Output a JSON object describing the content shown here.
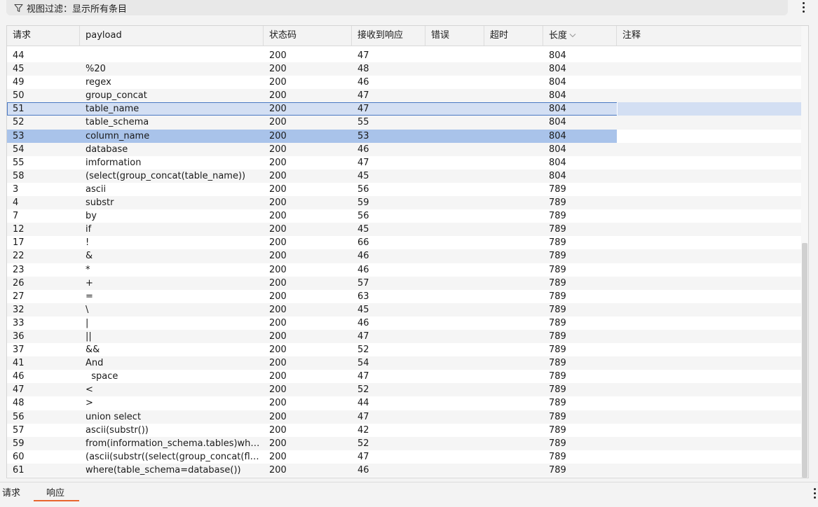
{
  "filter": {
    "label": "视图过滤：显示所有条目"
  },
  "columns": [
    "请求",
    "payload",
    "状态码",
    "接收到响应",
    "错误",
    "超时",
    "长度",
    "注释"
  ],
  "rows": [
    {
      "req": "44",
      "payload": "",
      "status": "200",
      "resp": "47",
      "err": "",
      "timeout": "",
      "len": "804",
      "note": ""
    },
    {
      "req": "45",
      "payload": "%20",
      "status": "200",
      "resp": "48",
      "err": "",
      "timeout": "",
      "len": "804",
      "note": ""
    },
    {
      "req": "49",
      "payload": "regex",
      "status": "200",
      "resp": "46",
      "err": "",
      "timeout": "",
      "len": "804",
      "note": ""
    },
    {
      "req": "50",
      "payload": "group_concat",
      "status": "200",
      "resp": "47",
      "err": "",
      "timeout": "",
      "len": "804",
      "note": ""
    },
    {
      "req": "51",
      "payload": "table_name",
      "status": "200",
      "resp": "47",
      "err": "",
      "timeout": "",
      "len": "804",
      "note": ""
    },
    {
      "req": "52",
      "payload": "table_schema",
      "status": "200",
      "resp": "55",
      "err": "",
      "timeout": "",
      "len": "804",
      "note": ""
    },
    {
      "req": "53",
      "payload": "column_name",
      "status": "200",
      "resp": "53",
      "err": "",
      "timeout": "",
      "len": "804",
      "note": ""
    },
    {
      "req": "54",
      "payload": "database",
      "status": "200",
      "resp": "46",
      "err": "",
      "timeout": "",
      "len": "804",
      "note": ""
    },
    {
      "req": "55",
      "payload": "imformation",
      "status": "200",
      "resp": "47",
      "err": "",
      "timeout": "",
      "len": "804",
      "note": ""
    },
    {
      "req": "58",
      "payload": "(select(group_concat(table_name))",
      "status": "200",
      "resp": "45",
      "err": "",
      "timeout": "",
      "len": "804",
      "note": ""
    },
    {
      "req": "3",
      "payload": "ascii",
      "status": "200",
      "resp": "56",
      "err": "",
      "timeout": "",
      "len": "789",
      "note": ""
    },
    {
      "req": "4",
      "payload": "substr",
      "status": "200",
      "resp": "59",
      "err": "",
      "timeout": "",
      "len": "789",
      "note": ""
    },
    {
      "req": "7",
      "payload": "by",
      "status": "200",
      "resp": "56",
      "err": "",
      "timeout": "",
      "len": "789",
      "note": ""
    },
    {
      "req": "12",
      "payload": "if",
      "status": "200",
      "resp": "45",
      "err": "",
      "timeout": "",
      "len": "789",
      "note": ""
    },
    {
      "req": "17",
      "payload": "!",
      "status": "200",
      "resp": "66",
      "err": "",
      "timeout": "",
      "len": "789",
      "note": ""
    },
    {
      "req": "22",
      "payload": "&",
      "status": "200",
      "resp": "46",
      "err": "",
      "timeout": "",
      "len": "789",
      "note": ""
    },
    {
      "req": "23",
      "payload": "*",
      "status": "200",
      "resp": "46",
      "err": "",
      "timeout": "",
      "len": "789",
      "note": ""
    },
    {
      "req": "26",
      "payload": "+",
      "status": "200",
      "resp": "57",
      "err": "",
      "timeout": "",
      "len": "789",
      "note": ""
    },
    {
      "req": "27",
      "payload": "=",
      "status": "200",
      "resp": "63",
      "err": "",
      "timeout": "",
      "len": "789",
      "note": ""
    },
    {
      "req": "32",
      "payload": "\\",
      "status": "200",
      "resp": "45",
      "err": "",
      "timeout": "",
      "len": "789",
      "note": ""
    },
    {
      "req": "33",
      "payload": "|",
      "status": "200",
      "resp": "46",
      "err": "",
      "timeout": "",
      "len": "789",
      "note": ""
    },
    {
      "req": "36",
      "payload": "||",
      "status": "200",
      "resp": "47",
      "err": "",
      "timeout": "",
      "len": "789",
      "note": ""
    },
    {
      "req": "37",
      "payload": "&&",
      "status": "200",
      "resp": "52",
      "err": "",
      "timeout": "",
      "len": "789",
      "note": ""
    },
    {
      "req": "41",
      "payload": "And",
      "status": "200",
      "resp": "54",
      "err": "",
      "timeout": "",
      "len": "789",
      "note": ""
    },
    {
      "req": "46",
      "payload": "  space",
      "status": "200",
      "resp": "47",
      "err": "",
      "timeout": "",
      "len": "789",
      "note": ""
    },
    {
      "req": "47",
      "payload": "<",
      "status": "200",
      "resp": "52",
      "err": "",
      "timeout": "",
      "len": "789",
      "note": ""
    },
    {
      "req": "48",
      "payload": ">",
      "status": "200",
      "resp": "44",
      "err": "",
      "timeout": "",
      "len": "789",
      "note": ""
    },
    {
      "req": "56",
      "payload": "union select",
      "status": "200",
      "resp": "47",
      "err": "",
      "timeout": "",
      "len": "789",
      "note": ""
    },
    {
      "req": "57",
      "payload": "ascii(substr())",
      "status": "200",
      "resp": "42",
      "err": "",
      "timeout": "",
      "len": "789",
      "note": ""
    },
    {
      "req": "59",
      "payload": "from(information_schema.tables)where...",
      "status": "200",
      "resp": "52",
      "err": "",
      "timeout": "",
      "len": "789",
      "note": ""
    },
    {
      "req": "60",
      "payload": "(ascii(substr((select(group_concat(flaaa...",
      "status": "200",
      "resp": "47",
      "err": "",
      "timeout": "",
      "len": "789",
      "note": ""
    },
    {
      "req": "61",
      "payload": "where(table_schema=database())",
      "status": "200",
      "resp": "46",
      "err": "",
      "timeout": "",
      "len": "789",
      "note": ""
    }
  ],
  "focused_row": "51",
  "selected_row": "53",
  "tabs": {
    "request": "请求",
    "response": "响应",
    "active": "response"
  },
  "colors": {
    "accent": "#e8652e",
    "selected": "#a9c3ea",
    "focused": "#d3dff3",
    "focus_border": "#4a78c2"
  },
  "icons": {
    "filter": "filter-icon",
    "sort": "sort-descending-icon",
    "menu": "kebab-menu-icon"
  }
}
